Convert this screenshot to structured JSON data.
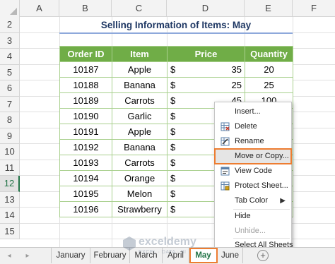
{
  "columns": [
    "A",
    "B",
    "C",
    "D",
    "E",
    "F"
  ],
  "rows": [
    "2",
    "3",
    "4",
    "5",
    "6",
    "7",
    "8",
    "9",
    "10",
    "11",
    "12",
    "13",
    "14",
    "15"
  ],
  "title": "Selling Information of Items: May",
  "table": {
    "headers": [
      "Order ID",
      "Item",
      "Price",
      "Quantity"
    ],
    "rows": [
      {
        "id": "10187",
        "item": "Apple",
        "cur": "$",
        "price": "35",
        "qty": "20"
      },
      {
        "id": "10188",
        "item": "Banana",
        "cur": "$",
        "price": "25",
        "qty": "25"
      },
      {
        "id": "10189",
        "item": "Carrots",
        "cur": "$",
        "price": "45",
        "qty": "100"
      },
      {
        "id": "10190",
        "item": "Garlic",
        "cur": "$",
        "price": "",
        "qty": ""
      },
      {
        "id": "10191",
        "item": "Apple",
        "cur": "$",
        "price": "",
        "qty": ""
      },
      {
        "id": "10192",
        "item": "Banana",
        "cur": "$",
        "price": "",
        "qty": ""
      },
      {
        "id": "10193",
        "item": "Carrots",
        "cur": "$",
        "price": "",
        "qty": ""
      },
      {
        "id": "10194",
        "item": "Orange",
        "cur": "$",
        "price": "",
        "qty": ""
      },
      {
        "id": "10195",
        "item": "Melon",
        "cur": "$",
        "price": "",
        "qty": ""
      },
      {
        "id": "10196",
        "item": "Strawberry",
        "cur": "$",
        "price": "",
        "qty": ""
      }
    ]
  },
  "context_menu": {
    "items": [
      {
        "label": "Insert...",
        "icon": "none",
        "disabled": false
      },
      {
        "label": "Delete",
        "icon": "delete-sheet-icon",
        "disabled": false
      },
      {
        "label": "Rename",
        "icon": "rename-icon",
        "disabled": false
      },
      {
        "label": "Move or Copy...",
        "icon": "none",
        "disabled": false,
        "highlighted": true
      },
      {
        "label": "View Code",
        "icon": "view-code-icon",
        "disabled": false
      },
      {
        "label": "Protect Sheet...",
        "icon": "protect-sheet-icon",
        "disabled": false
      },
      {
        "label": "Tab Color",
        "icon": "none",
        "disabled": false,
        "submenu": true
      },
      {
        "label": "Hide",
        "icon": "none",
        "disabled": false
      },
      {
        "label": "Unhide...",
        "icon": "none",
        "disabled": true
      },
      {
        "label": "Select All Sheets",
        "icon": "none",
        "disabled": false
      }
    ]
  },
  "sheet_tabs": {
    "tabs": [
      "January",
      "February",
      "March",
      "April",
      "May",
      "June"
    ],
    "active": "May",
    "nav_prev": "◂",
    "nav_next": "▸",
    "add": "+"
  },
  "watermark": {
    "name": "exceldemy",
    "tagline": "EXCEL · DATA · BI"
  },
  "colors": {
    "header_green": "#70ad47",
    "accent_orange": "#ed7d31",
    "excel_green": "#217346",
    "title_blue": "#1f3864"
  }
}
